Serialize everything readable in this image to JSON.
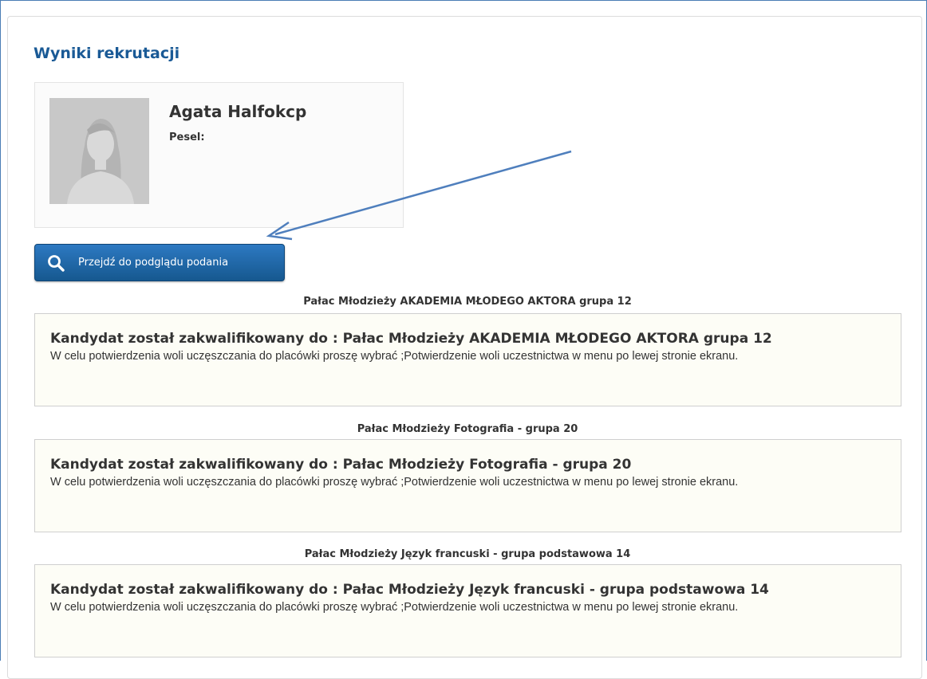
{
  "page": {
    "title": "Wyniki rekrutacji"
  },
  "profile": {
    "name": "Agata Halfokcp",
    "pesel_label": "Pesel:",
    "pesel_value": ""
  },
  "actions": {
    "preview_button_label": "Przejdź do podglądu podania",
    "preview_button_icon": "search-icon"
  },
  "colors": {
    "title": "#1a5a96",
    "button": "#1f67a8",
    "annotation_arrow": "#4f7fbd",
    "result_background": "#fdfdf6"
  },
  "results": [
    {
      "heading": "Pałac Młodzieży AKADEMIA MŁODEGO AKTORA grupa 12",
      "title": "Kandydat został zakwalifikowany do : Pałac Młodzieży AKADEMIA MŁODEGO AKTORA grupa 12",
      "text": "W celu potwierdzenia woli uczęszczania do placówki proszę wybrać ;Potwierdzenie woli uczestnictwa w menu po lewej stronie ekranu."
    },
    {
      "heading": "Pałac Młodzieży Fotografia - grupa 20",
      "title": "Kandydat został zakwalifikowany do : Pałac Młodzieży Fotografia - grupa 20",
      "text": "W celu potwierdzenia woli uczęszczania do placówki proszę wybrać ;Potwierdzenie woli uczestnictwa w menu po lewej stronie ekranu."
    },
    {
      "heading": "Pałac Młodzieży Język francuski - grupa podstawowa 14",
      "title": "Kandydat został zakwalifikowany do : Pałac Młodzieży Język francuski - grupa podstawowa 14",
      "text": "W celu potwierdzenia woli uczęszczania do placówki proszę wybrać ;Potwierdzenie woli uczestnictwa w menu po lewej stronie ekranu."
    }
  ]
}
